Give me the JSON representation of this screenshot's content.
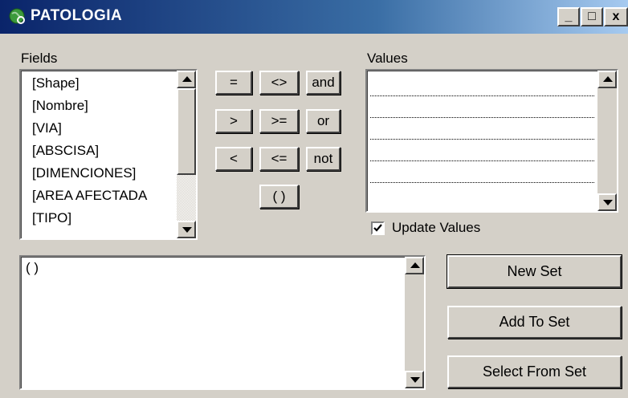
{
  "window": {
    "title": "PATOLOGIA",
    "controls": {
      "minimize": "_",
      "maximize": "□",
      "close": "x"
    }
  },
  "fields": {
    "label": "Fields",
    "items": [
      "[Shape]",
      "[Nombre]",
      "[VIA]",
      "[ABSCISA]",
      "[DIMENCIONES]",
      "[AREA AFECTADA",
      "[TIPO]"
    ]
  },
  "operators": {
    "eq": "=",
    "neq": "<>",
    "and": "and",
    "gt": ">",
    "gte": ">=",
    "or": "or",
    "lt": "<",
    "lte": "<=",
    "not": "not",
    "parens": "( )"
  },
  "values": {
    "label": "Values",
    "update_label": "Update Values",
    "update_checked": true
  },
  "expression": {
    "text": "( )"
  },
  "actions": {
    "new_set": "New Set",
    "add_to_set": "Add To Set",
    "select_from_set": "Select From Set"
  }
}
